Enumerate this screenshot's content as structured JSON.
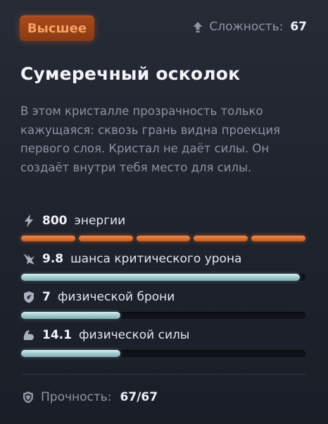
{
  "rarity": {
    "label": "Высшее",
    "color": "#a84a1c"
  },
  "difficulty": {
    "label": "Сложность:",
    "value": "67",
    "icon": "upgrade-arrow-icon"
  },
  "item": {
    "name": "Сумеречный осколок",
    "description": "В этом кристалле прозрачность только кажущаяся: сквозь грань видна проекция первого слоя. Кристал не даёт силы. Он создаёт внутри тебя место для силы."
  },
  "stats": [
    {
      "icon": "lightning-icon",
      "value": "800",
      "label": "энергии",
      "bar_type": "segments",
      "segments_total": 5,
      "segments_filled": 5
    },
    {
      "icon": "critical-hit-icon",
      "value": "9.8",
      "label": "шанса критического урона",
      "bar_type": "bar",
      "fill": 0.98
    },
    {
      "icon": "armor-shield-icon",
      "value": "7",
      "label": "физической брони",
      "bar_type": "bar",
      "fill": 0.35
    },
    {
      "icon": "muscle-arm-icon",
      "value": "14.1",
      "label": "физической силы",
      "bar_type": "bar",
      "fill": 0.35
    }
  ],
  "durability": {
    "label": "Прочность:",
    "value": "67/67",
    "icon": "durability-shield-icon"
  },
  "colors": {
    "accent_orange": "#e8783a",
    "bar_fill": "#a8d2d6",
    "text_muted": "#8c93a3"
  }
}
